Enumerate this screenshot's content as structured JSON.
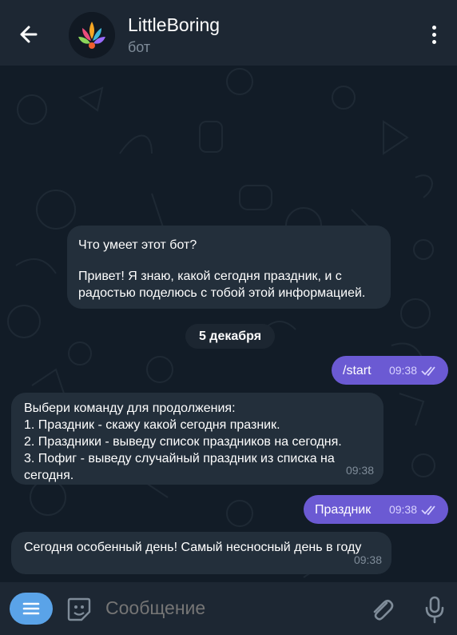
{
  "header": {
    "title": "LittleBoring",
    "subtitle": "бот"
  },
  "chat": {
    "intro": {
      "question": "Что умеет этот бот?",
      "line1": "Привет! Я знаю, какой сегодня праздник, и с",
      "line2": "радостью поделюсь с тобой этой информацией."
    },
    "date": "5 декабря",
    "messages": [
      {
        "direction": "out",
        "text": "/start",
        "time": "09:38"
      },
      {
        "direction": "in",
        "lines": [
          "Выбери команду для продолжения:",
          "1. Праздник - скажу какой сегодня празник.",
          "2. Праздники - выведу список праздников на сегодня.",
          "3. Пофиг - выведу случайный праздник из списка на",
          "сегодня."
        ],
        "time": "09:38"
      },
      {
        "direction": "out",
        "text": "Праздник",
        "time": "09:38"
      },
      {
        "direction": "in",
        "text": "Сегодня особенный день! Самый несносный день в году",
        "time": "09:38"
      }
    ]
  },
  "composer": {
    "placeholder": "Сообщение"
  },
  "colors": {
    "header_bg": "#1d2733",
    "chat_bg": "#121c27",
    "incoming_bubble": "#232f3b",
    "outgoing_bubble": "#6b5ad3",
    "menu_button": "#5aa3e8"
  },
  "icons": [
    "back-arrow-icon",
    "more-vertical-icon",
    "bot-avatar",
    "menu-lines-icon",
    "sticker-icon",
    "paperclip-icon",
    "microphone-icon",
    "double-check-icon"
  ]
}
